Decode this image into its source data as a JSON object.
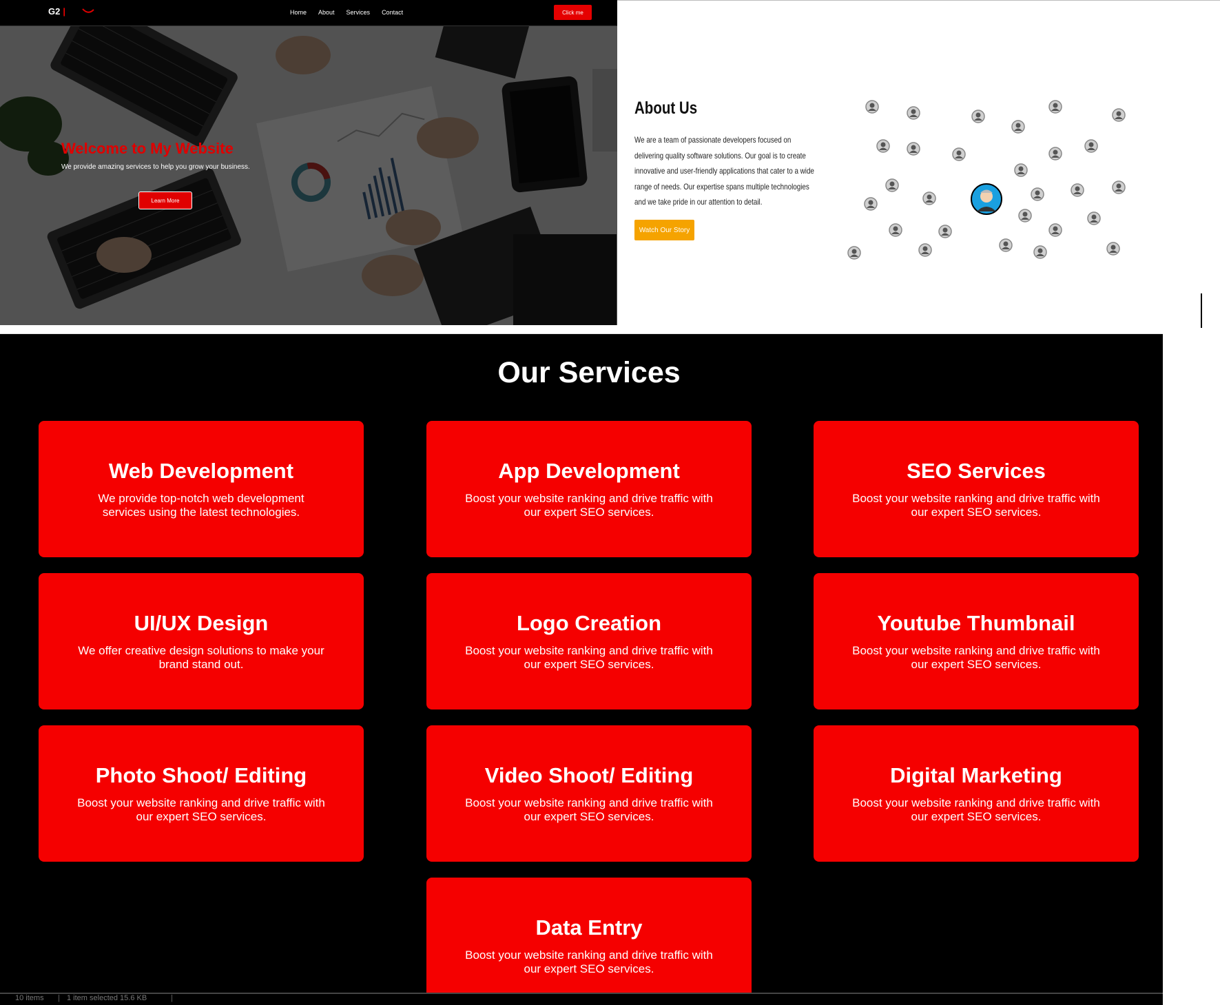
{
  "hero": {
    "logo_text": "G2",
    "logo_bar": "|",
    "nav": [
      "Home",
      "About",
      "Services",
      "Contact"
    ],
    "cta_label": "Click me",
    "title": "Welcome to My Website",
    "subtitle": "We provide amazing services to help you grow your business.",
    "button_label": "Learn More"
  },
  "about": {
    "title": "About Us",
    "text": "We are a team of passionate developers focused on delivering quality software solutions. Our goal is to create innovative and user-friendly applications that cater to a wide range of needs. Our expertise spans multiple technologies and we take pride in our attention to detail.",
    "button_label": "Watch Our Story"
  },
  "services": {
    "title": "Our Services",
    "cards": [
      {
        "title": "Web Development",
        "desc": "We provide top-notch web development services using the latest technologies."
      },
      {
        "title": "App Development",
        "desc": "Boost your website ranking and drive traffic with our expert SEO services."
      },
      {
        "title": "SEO Services",
        "desc": "Boost your website ranking and drive traffic with our expert SEO services."
      },
      {
        "title": "UI/UX Design",
        "desc": "We offer creative design solutions to make your brand stand out."
      },
      {
        "title": "Logo Creation",
        "desc": "Boost your website ranking and drive traffic with our expert SEO services."
      },
      {
        "title": "Youtube Thumbnail",
        "desc": "Boost your website ranking and drive traffic with our expert SEO services."
      },
      {
        "title": "Photo Shoot/ Editing",
        "desc": "Boost your website ranking and drive traffic with our expert SEO services."
      },
      {
        "title": "Video Shoot/ Editing",
        "desc": "Boost your website ranking and drive traffic with our expert SEO services."
      },
      {
        "title": "Digital Marketing",
        "desc": "Boost your website ranking and drive traffic with our expert SEO services."
      },
      {
        "title": "Data Entry",
        "desc": "Boost your website ranking and drive traffic with our expert SEO services."
      }
    ]
  },
  "statusbar": {
    "items": "10 items",
    "selected": "1 item selected  15.6 KB"
  },
  "colors": {
    "accent_red": "#f50000",
    "about_button": "#f5a300",
    "services_bg": "#000000"
  }
}
